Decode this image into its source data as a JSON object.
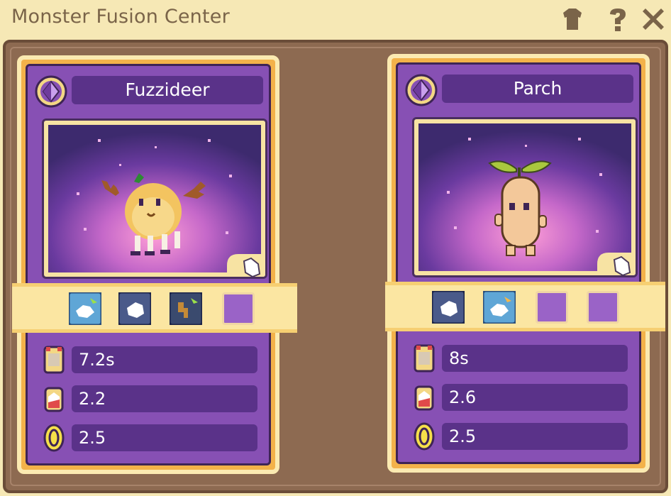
{
  "window": {
    "title": "Monster Fusion Center",
    "buttons": [
      {
        "name": "shirt-icon"
      },
      {
        "name": "help-icon"
      },
      {
        "name": "close-icon"
      }
    ]
  },
  "colors": {
    "card_border": "#f3b24a",
    "card_body": "#8750b4",
    "name_box": "#5a3289",
    "frame": "#8d6a51",
    "background": "#f6e8b5"
  },
  "cards": [
    {
      "name": "Fuzzideer",
      "creature": "fuzzy-deer",
      "ability_slots": [
        "wing-glove-icon",
        "glove-icon",
        "antler-icon",
        "empty"
      ],
      "stats": [
        {
          "icon": "time-icon",
          "value": "7.2s"
        },
        {
          "icon": "potion-icon",
          "value": "2.2"
        },
        {
          "icon": "coin-icon",
          "value": "2.5"
        }
      ]
    },
    {
      "name": "Parch",
      "creature": "sprout-root",
      "ability_slots": [
        "glove-icon",
        "wing-glove-icon",
        "empty",
        "empty"
      ],
      "stats": [
        {
          "icon": "time-icon",
          "value": "8s"
        },
        {
          "icon": "potion-icon",
          "value": "2.6"
        },
        {
          "icon": "coin-icon",
          "value": "2.5"
        }
      ]
    }
  ]
}
